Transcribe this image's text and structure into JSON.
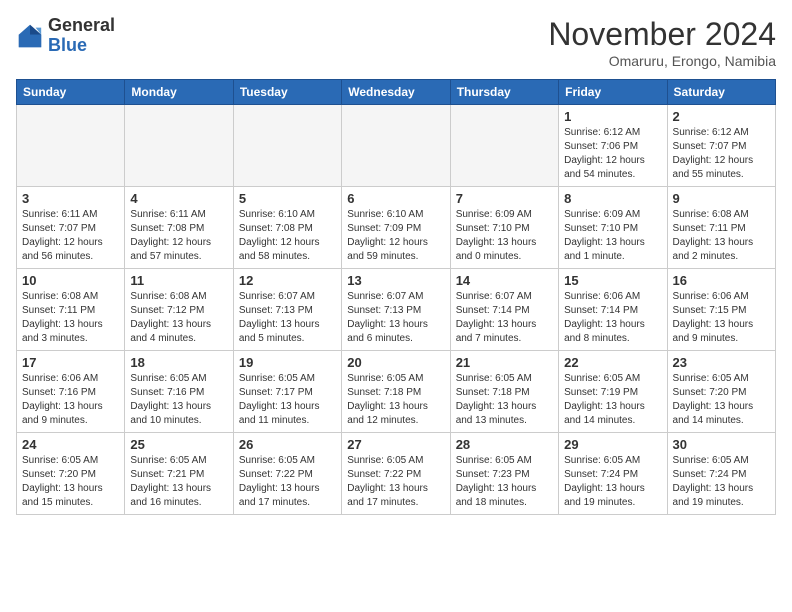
{
  "header": {
    "logo_line1": "General",
    "logo_line2": "Blue",
    "month": "November 2024",
    "location": "Omaruru, Erongo, Namibia"
  },
  "weekdays": [
    "Sunday",
    "Monday",
    "Tuesday",
    "Wednesday",
    "Thursday",
    "Friday",
    "Saturday"
  ],
  "weeks": [
    [
      {
        "day": "",
        "info": ""
      },
      {
        "day": "",
        "info": ""
      },
      {
        "day": "",
        "info": ""
      },
      {
        "day": "",
        "info": ""
      },
      {
        "day": "",
        "info": ""
      },
      {
        "day": "1",
        "info": "Sunrise: 6:12 AM\nSunset: 7:06 PM\nDaylight: 12 hours\nand 54 minutes."
      },
      {
        "day": "2",
        "info": "Sunrise: 6:12 AM\nSunset: 7:07 PM\nDaylight: 12 hours\nand 55 minutes."
      }
    ],
    [
      {
        "day": "3",
        "info": "Sunrise: 6:11 AM\nSunset: 7:07 PM\nDaylight: 12 hours\nand 56 minutes."
      },
      {
        "day": "4",
        "info": "Sunrise: 6:11 AM\nSunset: 7:08 PM\nDaylight: 12 hours\nand 57 minutes."
      },
      {
        "day": "5",
        "info": "Sunrise: 6:10 AM\nSunset: 7:08 PM\nDaylight: 12 hours\nand 58 minutes."
      },
      {
        "day": "6",
        "info": "Sunrise: 6:10 AM\nSunset: 7:09 PM\nDaylight: 12 hours\nand 59 minutes."
      },
      {
        "day": "7",
        "info": "Sunrise: 6:09 AM\nSunset: 7:10 PM\nDaylight: 13 hours\nand 0 minutes."
      },
      {
        "day": "8",
        "info": "Sunrise: 6:09 AM\nSunset: 7:10 PM\nDaylight: 13 hours\nand 1 minute."
      },
      {
        "day": "9",
        "info": "Sunrise: 6:08 AM\nSunset: 7:11 PM\nDaylight: 13 hours\nand 2 minutes."
      }
    ],
    [
      {
        "day": "10",
        "info": "Sunrise: 6:08 AM\nSunset: 7:11 PM\nDaylight: 13 hours\nand 3 minutes."
      },
      {
        "day": "11",
        "info": "Sunrise: 6:08 AM\nSunset: 7:12 PM\nDaylight: 13 hours\nand 4 minutes."
      },
      {
        "day": "12",
        "info": "Sunrise: 6:07 AM\nSunset: 7:13 PM\nDaylight: 13 hours\nand 5 minutes."
      },
      {
        "day": "13",
        "info": "Sunrise: 6:07 AM\nSunset: 7:13 PM\nDaylight: 13 hours\nand 6 minutes."
      },
      {
        "day": "14",
        "info": "Sunrise: 6:07 AM\nSunset: 7:14 PM\nDaylight: 13 hours\nand 7 minutes."
      },
      {
        "day": "15",
        "info": "Sunrise: 6:06 AM\nSunset: 7:14 PM\nDaylight: 13 hours\nand 8 minutes."
      },
      {
        "day": "16",
        "info": "Sunrise: 6:06 AM\nSunset: 7:15 PM\nDaylight: 13 hours\nand 9 minutes."
      }
    ],
    [
      {
        "day": "17",
        "info": "Sunrise: 6:06 AM\nSunset: 7:16 PM\nDaylight: 13 hours\nand 9 minutes."
      },
      {
        "day": "18",
        "info": "Sunrise: 6:05 AM\nSunset: 7:16 PM\nDaylight: 13 hours\nand 10 minutes."
      },
      {
        "day": "19",
        "info": "Sunrise: 6:05 AM\nSunset: 7:17 PM\nDaylight: 13 hours\nand 11 minutes."
      },
      {
        "day": "20",
        "info": "Sunrise: 6:05 AM\nSunset: 7:18 PM\nDaylight: 13 hours\nand 12 minutes."
      },
      {
        "day": "21",
        "info": "Sunrise: 6:05 AM\nSunset: 7:18 PM\nDaylight: 13 hours\nand 13 minutes."
      },
      {
        "day": "22",
        "info": "Sunrise: 6:05 AM\nSunset: 7:19 PM\nDaylight: 13 hours\nand 14 minutes."
      },
      {
        "day": "23",
        "info": "Sunrise: 6:05 AM\nSunset: 7:20 PM\nDaylight: 13 hours\nand 14 minutes."
      }
    ],
    [
      {
        "day": "24",
        "info": "Sunrise: 6:05 AM\nSunset: 7:20 PM\nDaylight: 13 hours\nand 15 minutes."
      },
      {
        "day": "25",
        "info": "Sunrise: 6:05 AM\nSunset: 7:21 PM\nDaylight: 13 hours\nand 16 minutes."
      },
      {
        "day": "26",
        "info": "Sunrise: 6:05 AM\nSunset: 7:22 PM\nDaylight: 13 hours\nand 17 minutes."
      },
      {
        "day": "27",
        "info": "Sunrise: 6:05 AM\nSunset: 7:22 PM\nDaylight: 13 hours\nand 17 minutes."
      },
      {
        "day": "28",
        "info": "Sunrise: 6:05 AM\nSunset: 7:23 PM\nDaylight: 13 hours\nand 18 minutes."
      },
      {
        "day": "29",
        "info": "Sunrise: 6:05 AM\nSunset: 7:24 PM\nDaylight: 13 hours\nand 19 minutes."
      },
      {
        "day": "30",
        "info": "Sunrise: 6:05 AM\nSunset: 7:24 PM\nDaylight: 13 hours\nand 19 minutes."
      }
    ]
  ]
}
